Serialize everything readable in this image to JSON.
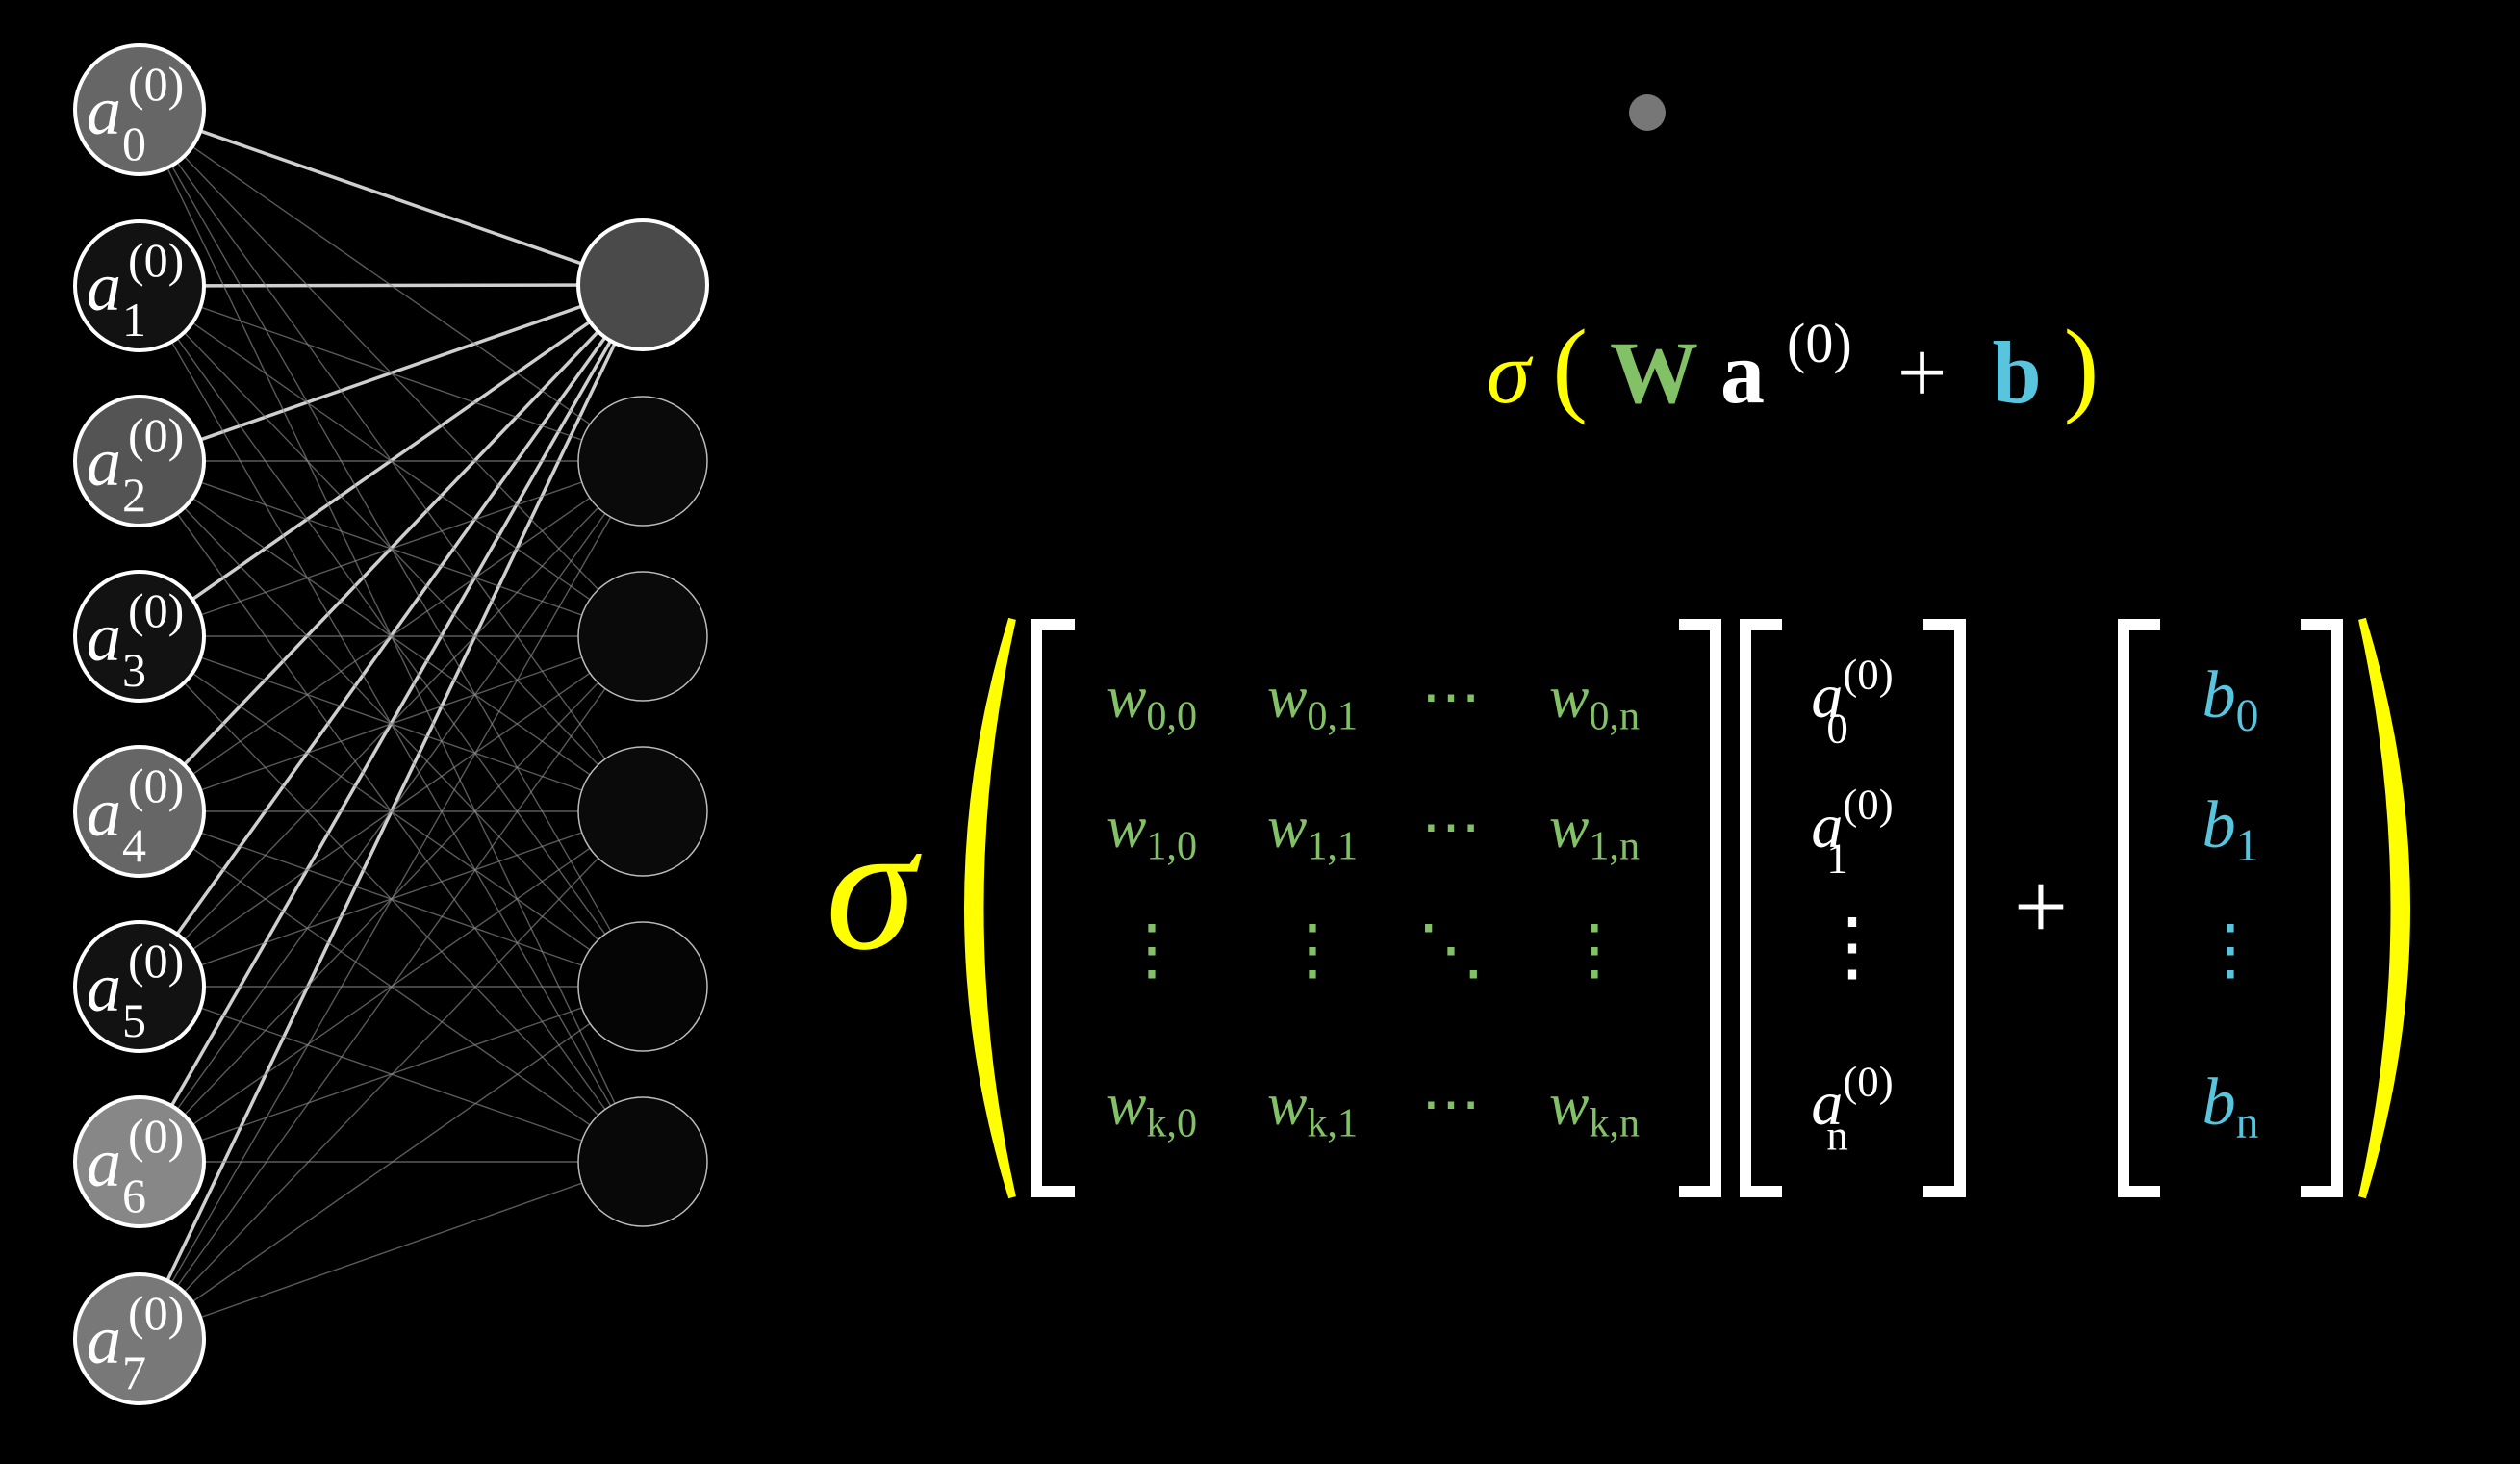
{
  "colors": {
    "background": "#000000",
    "weights": "#83C167",
    "bias": "#58C4DD",
    "sigma": "#FFFF00",
    "text": "#FFFFFF",
    "marker_dot": "#777777"
  },
  "network": {
    "input_labels": [
      {
        "base": "a",
        "sub": "0",
        "sup": "(0)"
      },
      {
        "base": "a",
        "sub": "1",
        "sup": "(0)"
      },
      {
        "base": "a",
        "sub": "2",
        "sup": "(0)"
      },
      {
        "base": "a",
        "sub": "3",
        "sup": "(0)"
      },
      {
        "base": "a",
        "sub": "4",
        "sup": "(0)"
      },
      {
        "base": "a",
        "sub": "5",
        "sup": "(0)"
      },
      {
        "base": "a",
        "sub": "6",
        "sup": "(0)"
      },
      {
        "base": "a",
        "sub": "7",
        "sup": "(0)"
      }
    ],
    "input_activations": [
      0.4,
      0.07,
      0.33,
      0.07,
      0.4,
      0.07,
      0.53,
      0.47
    ],
    "output_activations": [
      0.29,
      0.04,
      0.04,
      0.04,
      0.02,
      0.03
    ],
    "highlighted_output": 0
  },
  "formula_compact": {
    "sigma": "σ",
    "open": "(",
    "W": "W",
    "a": "a",
    "sup": "(0)",
    "plus": "+",
    "b": "b",
    "close": ")"
  },
  "expanded": {
    "sigma": "σ",
    "plus": "+",
    "matrix": [
      [
        {
          "base": "w",
          "sub": "0,0"
        },
        {
          "base": "w",
          "sub": "0,1"
        },
        {
          "base": "⋯",
          "sub": ""
        },
        {
          "base": "w",
          "sub": "0,n"
        }
      ],
      [
        {
          "base": "w",
          "sub": "1,0"
        },
        {
          "base": "w",
          "sub": "1,1"
        },
        {
          "base": "⋯",
          "sub": ""
        },
        {
          "base": "w",
          "sub": "1,n"
        }
      ],
      [
        {
          "base": "⋮",
          "sub": ""
        },
        {
          "base": "⋮",
          "sub": ""
        },
        {
          "base": "⋱",
          "sub": ""
        },
        {
          "base": "⋮",
          "sub": ""
        }
      ],
      [
        {
          "base": "w",
          "sub": "k,0"
        },
        {
          "base": "w",
          "sub": "k,1"
        },
        {
          "base": "⋯",
          "sub": ""
        },
        {
          "base": "w",
          "sub": "k,n"
        }
      ]
    ],
    "vector_a": [
      {
        "base": "a",
        "sub": "0",
        "sup": "(0)"
      },
      {
        "base": "a",
        "sub": "1",
        "sup": "(0)"
      },
      {
        "base": "⋮",
        "sub": "",
        "sup": ""
      },
      {
        "base": "a",
        "sub": "n",
        "sup": "(0)"
      }
    ],
    "vector_b": [
      {
        "base": "b",
        "sub": "0"
      },
      {
        "base": "b",
        "sub": "1"
      },
      {
        "base": "⋮",
        "sub": ""
      },
      {
        "base": "b",
        "sub": "n"
      }
    ]
  }
}
